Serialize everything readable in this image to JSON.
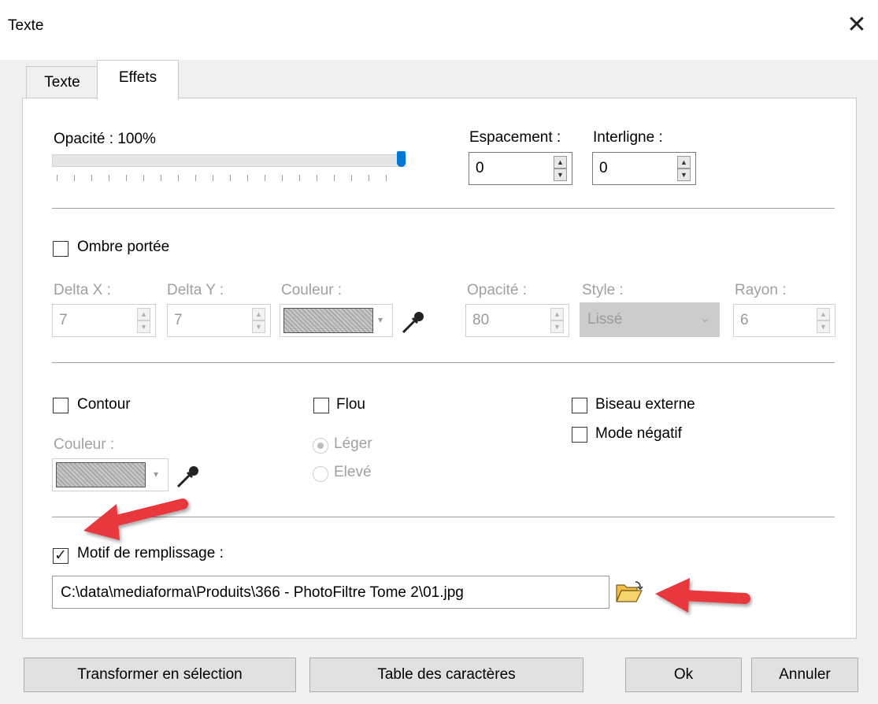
{
  "window": {
    "title": "Texte",
    "close_symbol": "✕"
  },
  "tabs": [
    {
      "label": "Texte",
      "active": false
    },
    {
      "label": "Effets",
      "active": true
    }
  ],
  "opacity": {
    "label": "Opacité : 100%",
    "value_percent": 100
  },
  "espacement": {
    "label": "Espacement :",
    "value": "0"
  },
  "interligne": {
    "label": "Interligne :",
    "value": "0"
  },
  "ombre": {
    "label": "Ombre portée",
    "checked": false,
    "delta_x": {
      "label": "Delta X :",
      "value": "7"
    },
    "delta_y": {
      "label": "Delta Y :",
      "value": "7"
    },
    "couleur_label": "Couleur :",
    "opacite": {
      "label": "Opacité :",
      "value": "80"
    },
    "style": {
      "label": "Style :",
      "value": "Lissé"
    },
    "rayon": {
      "label": "Rayon :",
      "value": "6"
    }
  },
  "contour": {
    "label": "Contour",
    "checked": false,
    "couleur_label": "Couleur :"
  },
  "flou": {
    "label": "Flou",
    "checked": false,
    "options": [
      "Léger",
      "Elevé"
    ],
    "selected": "Léger"
  },
  "biseau": {
    "label": "Biseau externe",
    "checked": false
  },
  "mode_negatif": {
    "label": "Mode négatif",
    "checked": false
  },
  "motif": {
    "label": "Motif de remplissage :",
    "checked": true,
    "path": "C:\\data\\mediaforma\\Produits\\366 - PhotoFiltre Tome 2\\01.jpg"
  },
  "buttons": {
    "transformer": "Transformer en sélection",
    "table": "Table des caractères",
    "ok": "Ok",
    "annuler": "Annuler"
  },
  "colors": {
    "accent": "#0078d7",
    "annotation_arrow": "#e8383c",
    "folder": "#f2c04a"
  },
  "icons": [
    "close-icon",
    "eyedropper-icon",
    "folder-open-icon",
    "chevron-down-icon",
    "spin-up-icon",
    "spin-down-icon"
  ]
}
